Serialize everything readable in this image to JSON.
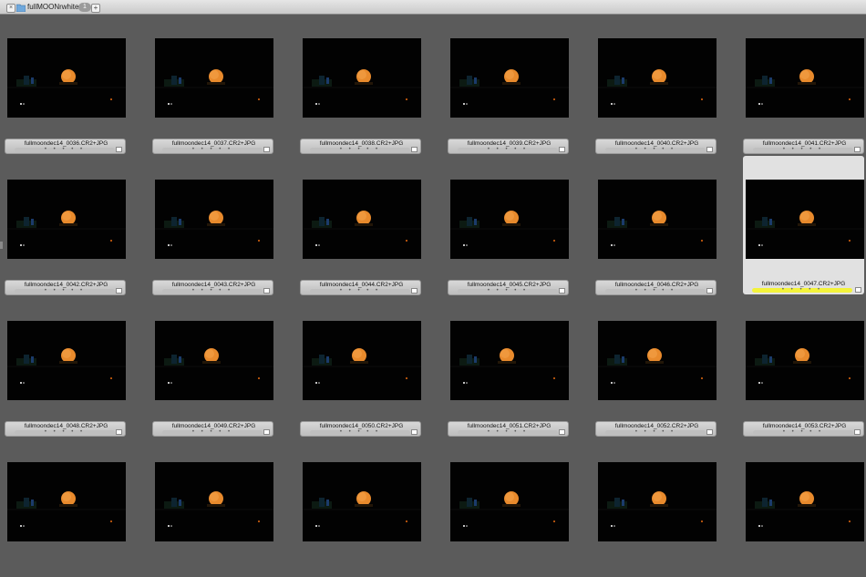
{
  "tab": {
    "title": "fullMOONrwhite",
    "count": "1",
    "close_glyph": "×",
    "add_glyph": "+"
  },
  "rating_dots": "• • • • •",
  "accent_color": "#f3f33a",
  "thumbnails": [
    {
      "filename": "fullmoondec14_0036.CR2+JPG",
      "moon": "high"
    },
    {
      "filename": "fullmoondec14_0037.CR2+JPG",
      "moon": "high"
    },
    {
      "filename": "fullmoondec14_0038.CR2+JPG",
      "moon": "high"
    },
    {
      "filename": "fullmoondec14_0039.CR2+JPG",
      "moon": "high"
    },
    {
      "filename": "fullmoondec14_0040.CR2+JPG",
      "moon": "high"
    },
    {
      "filename": "fullmoondec14_0041.CR2+JPG",
      "moon": "high"
    },
    {
      "filename": "fullmoondec14_0042.CR2+JPG",
      "moon": "high"
    },
    {
      "filename": "fullmoondec14_0043.CR2+JPG",
      "moon": "high"
    },
    {
      "filename": "fullmoondec14_0044.CR2+JPG",
      "moon": "high"
    },
    {
      "filename": "fullmoondec14_0045.CR2+JPG",
      "moon": "high"
    },
    {
      "filename": "fullmoondec14_0046.CR2+JPG",
      "moon": "high"
    },
    {
      "filename": "fullmoondec14_0047.CR2+JPG",
      "moon": "high",
      "selected": true
    },
    {
      "filename": "fullmoondec14_0048.CR2+JPG",
      "moon": "high"
    },
    {
      "filename": "fullmoondec14_0049.CR2+JPG",
      "moon": "high"
    },
    {
      "filename": "fullmoondec14_0050.CR2+JPG",
      "moon": "high"
    },
    {
      "filename": "fullmoondec14_0051.CR2+JPG",
      "moon": "high"
    },
    {
      "filename": "fullmoondec14_0052.CR2+JPG",
      "moon": "high"
    },
    {
      "filename": "fullmoondec14_0053.CR2+JPG",
      "moon": "high"
    },
    {
      "filename": "",
      "moon": "low"
    },
    {
      "filename": "",
      "moon": "low"
    },
    {
      "filename": "",
      "moon": "low"
    },
    {
      "filename": "",
      "moon": "low"
    },
    {
      "filename": "",
      "moon": "low"
    },
    {
      "filename": "",
      "moon": "low"
    }
  ]
}
